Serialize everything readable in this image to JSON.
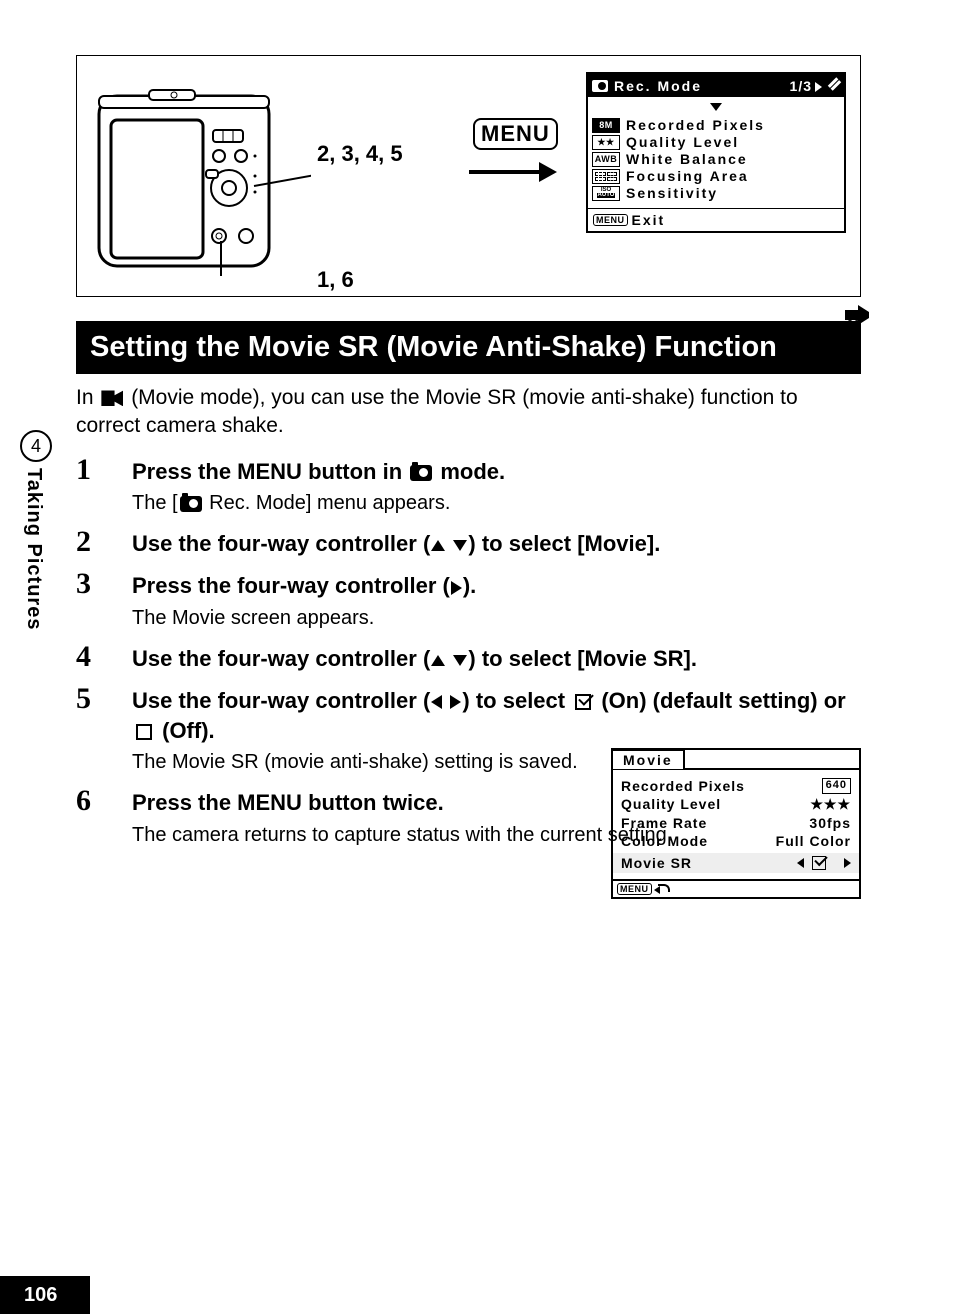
{
  "sidebar": {
    "chapter_num": "4",
    "chapter_title": "Taking Pictures"
  },
  "diagram": {
    "step_upper": "2, 3, 4, 5",
    "step_lower": "1, 6",
    "menu_button": "MENU"
  },
  "rec_mode_menu": {
    "title": "Rec. Mode",
    "page_indicator": "1/3",
    "items": [
      {
        "badge": "8M",
        "label": "Recorded Pixels",
        "selected": true
      },
      {
        "badge": "★★",
        "label": "Quality Level",
        "selected": false
      },
      {
        "badge": "AWB",
        "label": "White Balance",
        "selected": false
      },
      {
        "badge": "focus",
        "label": "Focusing Area",
        "selected": false
      },
      {
        "badge": "iso",
        "label": "Sensitivity",
        "selected": false
      }
    ],
    "footer_menu": "MENU",
    "footer_text": "Exit"
  },
  "heading": "Setting the Movie SR (Movie Anti-Shake) Function",
  "intro_pre": "In ",
  "intro_mid": " (Movie mode), you can use the Movie SR (movie anti-shake) function to correct camera shake.",
  "steps": {
    "s1": {
      "num": "1",
      "title_a": "Press the ",
      "title_menu": "MENU",
      "title_b": " button in ",
      "title_c": " mode.",
      "desc_a": "The [",
      "desc_b": " Rec. Mode] menu appears."
    },
    "s2": {
      "num": "2",
      "title_a": "Use the four-way controller (",
      "title_b": ") to select [Movie]."
    },
    "s3": {
      "num": "3",
      "title_a": "Press the four-way controller (",
      "title_b": ").",
      "desc": "The Movie screen appears."
    },
    "s4": {
      "num": "4",
      "title_a": "Use the four-way controller (",
      "title_b": ") to select [Movie SR]."
    },
    "s5": {
      "num": "5",
      "title_a": "Use the four-way controller (",
      "title_b": ") to select ",
      "title_on": " (On) (default setting) or ",
      "title_off": " (Off).",
      "desc": "The Movie SR (movie anti-shake) setting is saved."
    },
    "s6": {
      "num": "6",
      "title_a": "Press the ",
      "title_menu": "MENU",
      "title_b": " button twice.",
      "desc": "The camera returns to capture status with the current setting."
    }
  },
  "movie_menu": {
    "title": "Movie",
    "rows": [
      {
        "label": "Recorded Pixels",
        "value": "640"
      },
      {
        "label": "Quality Level",
        "value": "★★★"
      },
      {
        "label": "Frame Rate",
        "value": "30fps"
      },
      {
        "label": "Color Mode",
        "value": "Full Color"
      }
    ],
    "sr_label": "Movie SR",
    "footer_menu": "MENU"
  },
  "page_number": "106"
}
